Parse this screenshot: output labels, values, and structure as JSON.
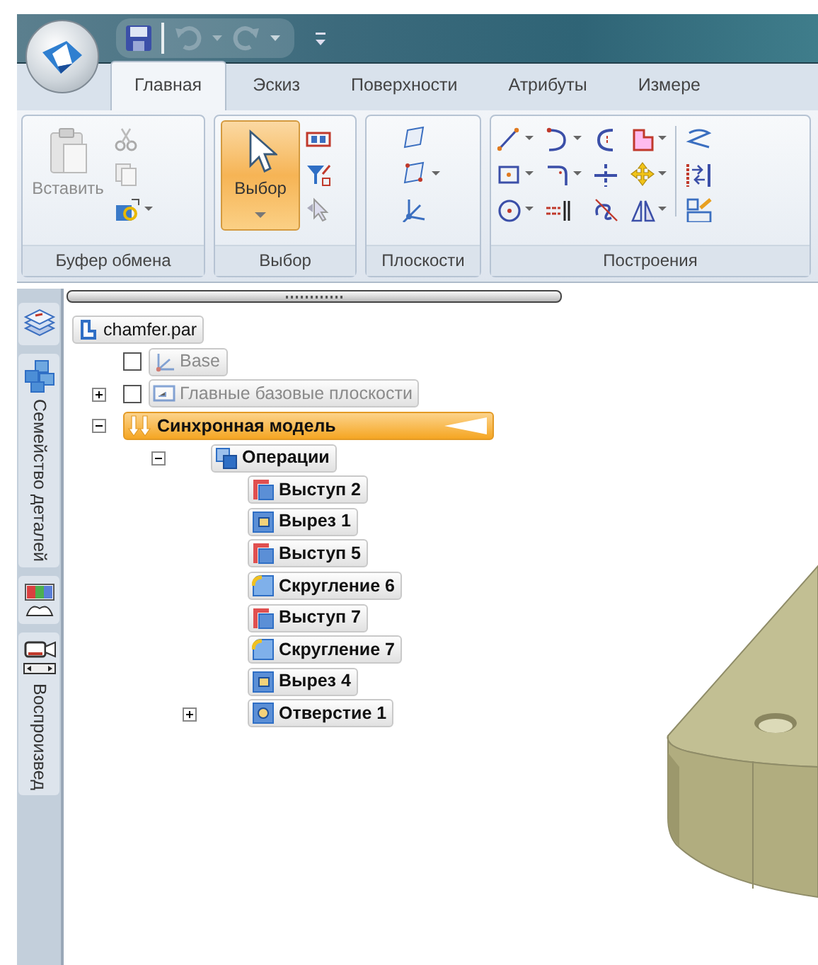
{
  "ribbon_tabs": [
    {
      "label": "Главная",
      "selected": true
    },
    {
      "label": "Эскиз",
      "selected": false
    },
    {
      "label": "Поверхности",
      "selected": false
    },
    {
      "label": "Атрибуты",
      "selected": false
    },
    {
      "label": "Измере",
      "selected": false
    }
  ],
  "ribbon_groups": [
    {
      "label": "Буфер обмена",
      "buttons": [
        {
          "label": "Вставить",
          "disabled": true,
          "active": false
        }
      ]
    },
    {
      "label": "Выбор",
      "buttons": [
        {
          "label": "Выбор",
          "disabled": false,
          "active": true
        }
      ]
    },
    {
      "label": "Плоскости"
    },
    {
      "label": "Построения"
    }
  ],
  "side_tabs": [
    {
      "kind": "icon"
    },
    {
      "kind": "labeled",
      "label": "Семейство деталей"
    },
    {
      "kind": "icon"
    },
    {
      "kind": "labeled",
      "label": "Воспроизвед"
    }
  ],
  "tree": {
    "label": "chamfer.par",
    "kind": "part",
    "bold": false,
    "dimmed": false,
    "selected": false,
    "children": [
      {
        "label": "Base",
        "kind": "coordinate-system",
        "checked": false,
        "bold": false,
        "dimmed": true,
        "selected": false
      },
      {
        "label": "Главные базовые плоскости",
        "kind": "plane-set",
        "checked": false,
        "expanded": false,
        "bold": false,
        "dimmed": true,
        "selected": false
      },
      {
        "label": "Синхронная модель",
        "kind": "synchronous",
        "expanded": true,
        "bold": true,
        "dimmed": false,
        "selected": true,
        "children": [
          {
            "label": "Операции",
            "kind": "feature-group",
            "expanded": true,
            "bold": true,
            "dimmed": false,
            "selected": false,
            "children": [
              {
                "label": "Выступ 2",
                "kind": "protrusion",
                "bold": true,
                "dimmed": false,
                "selected": false
              },
              {
                "label": "Вырез 1",
                "kind": "cutout",
                "bold": true,
                "dimmed": false,
                "selected": false
              },
              {
                "label": "Выступ 5",
                "kind": "protrusion",
                "bold": true,
                "dimmed": false,
                "selected": false
              },
              {
                "label": "Скругление 6",
                "kind": "round",
                "bold": true,
                "dimmed": false,
                "selected": false
              },
              {
                "label": "Выступ 7",
                "kind": "protrusion",
                "bold": true,
                "dimmed": false,
                "selected": false
              },
              {
                "label": "Скругление 7",
                "kind": "round",
                "bold": true,
                "dimmed": false,
                "selected": false
              },
              {
                "label": "Вырез 4",
                "kind": "cutout",
                "bold": true,
                "dimmed": false,
                "selected": false
              },
              {
                "label": "Отверстие 1",
                "kind": "hole",
                "expanded": false,
                "bold": true,
                "dimmed": false,
                "selected": false
              }
            ]
          }
        ]
      }
    ]
  }
}
